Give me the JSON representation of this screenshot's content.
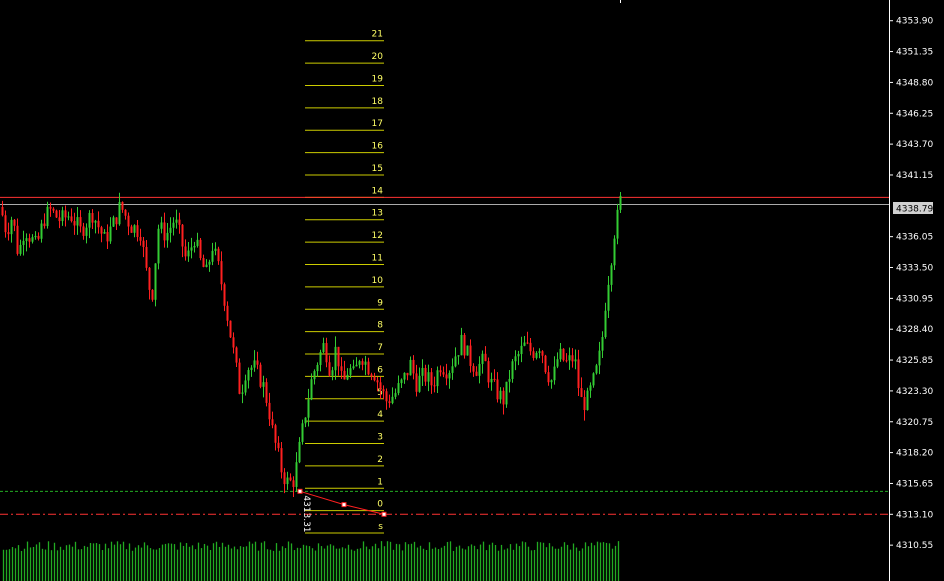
{
  "chart_data": {
    "type": "candlestick",
    "ylim": [
      4308.0,
      4355.2
    ],
    "y_ticks": [
      "4353.90",
      "4351.35",
      "4348.80",
      "4346.25",
      "4343.70",
      "4341.15",
      "4338.79",
      "4336.05",
      "4333.50",
      "4330.95",
      "4328.40",
      "4325.85",
      "4323.30",
      "4320.75",
      "4318.20",
      "4315.65",
      "4313.10",
      "4310.55"
    ],
    "current_price": "4338.79",
    "current_price_value": 4338.79,
    "resistance_value": 4339.3,
    "support_value": 4313.1,
    "dotted_level_value": 4315.0,
    "fib_levels": [
      "s",
      "0",
      "1",
      "2",
      "3",
      "4",
      "5",
      "6",
      "7",
      "8",
      "9",
      "10",
      "11",
      "12",
      "13",
      "14",
      "15",
      "16",
      "17",
      "18",
      "19",
      "20",
      "21"
    ],
    "fib_base_value": 4313.4,
    "fib_step": 1.85,
    "trend_line_points": [
      [
        4315.0
      ],
      [
        4313.9
      ],
      [
        4313.1
      ]
    ],
    "annotation_text": "4313.31",
    "colors": {
      "bull": "#33cc33",
      "bear": "#ff2020",
      "volume": "#22aa22",
      "fib": "#cccc00",
      "resistance": "#ff3333",
      "support": "#ff3333",
      "dotted": "#22aa22",
      "price_line": "#aaaaaa",
      "price_box": "#d0d0d0"
    },
    "anchors": [
      [
        0,
        4338.5
      ],
      [
        6,
        4336.5
      ],
      [
        12,
        4337.8
      ],
      [
        18,
        4334.5
      ],
      [
        24,
        4336.8
      ],
      [
        30,
        4336.0
      ],
      [
        36,
        4335.2
      ],
      [
        44,
        4337.6
      ],
      [
        50,
        4338.2
      ],
      [
        60,
        4337.4
      ],
      [
        70,
        4337.9
      ],
      [
        80,
        4336.5
      ],
      [
        92,
        4338.0
      ],
      [
        104,
        4335.8
      ],
      [
        112,
        4336.9
      ],
      [
        120,
        4338.6
      ],
      [
        130,
        4337.0
      ],
      [
        140,
        4336.5
      ],
      [
        148,
        4332.0
      ],
      [
        152,
        4331.5
      ],
      [
        158,
        4336.8
      ],
      [
        166,
        4336.2
      ],
      [
        174,
        4337.5
      ],
      [
        180,
        4336.0
      ],
      [
        186,
        4334.0
      ],
      [
        194,
        4336.0
      ],
      [
        200,
        4334.0
      ],
      [
        206,
        4333.0
      ],
      [
        212,
        4335.3
      ],
      [
        218,
        4333.5
      ],
      [
        224,
        4331.0
      ],
      [
        230,
        4328.0
      ],
      [
        236,
        4325.0
      ],
      [
        240,
        4323.0
      ],
      [
        246,
        4325.3
      ],
      [
        254,
        4325.2
      ],
      [
        262,
        4324.0
      ],
      [
        268,
        4322.0
      ],
      [
        272,
        4320.0
      ],
      [
        276,
        4318.5
      ],
      [
        282,
        4316.5
      ],
      [
        288,
        4315.6
      ],
      [
        294,
        4316.0
      ],
      [
        300,
        4319.0
      ],
      [
        306,
        4322.0
      ],
      [
        312,
        4324.5
      ],
      [
        318,
        4326.0
      ],
      [
        324,
        4327.2
      ],
      [
        330,
        4325.0
      ],
      [
        336,
        4327.0
      ],
      [
        342,
        4323.6
      ],
      [
        348,
        4325.2
      ],
      [
        354,
        4324.5
      ],
      [
        360,
        4326.5
      ],
      [
        366,
        4325.5
      ],
      [
        374,
        4324.8
      ],
      [
        380,
        4323.5
      ],
      [
        386,
        4322.5
      ],
      [
        394,
        4323.0
      ],
      [
        402,
        4324.0
      ],
      [
        410,
        4325.5
      ],
      [
        416,
        4324.0
      ],
      [
        424,
        4324.6
      ],
      [
        432,
        4323.8
      ],
      [
        440,
        4325.5
      ],
      [
        448,
        4325.0
      ],
      [
        456,
        4326.5
      ],
      [
        462,
        4327.5
      ],
      [
        468,
        4326.0
      ],
      [
        476,
        4325.2
      ],
      [
        484,
        4325.8
      ],
      [
        490,
        4324.0
      ],
      [
        498,
        4323.0
      ],
      [
        504,
        4322.5
      ],
      [
        510,
        4325.0
      ],
      [
        516,
        4326.0
      ],
      [
        524,
        4327.0
      ],
      [
        532,
        4326.5
      ],
      [
        540,
        4327.2
      ],
      [
        546,
        4325.0
      ],
      [
        552,
        4324.0
      ],
      [
        558,
        4326.3
      ],
      [
        566,
        4325.6
      ],
      [
        574,
        4326.1
      ],
      [
        580,
        4322.5
      ],
      [
        586,
        4322.3
      ],
      [
        592,
        4323.8
      ],
      [
        598,
        4325.5
      ],
      [
        602,
        4327.8
      ],
      [
        606,
        4331.5
      ],
      [
        610,
        4333.8
      ],
      [
        614,
        4336.5
      ],
      [
        618,
        4338.0
      ],
      [
        620,
        4339.0
      ]
    ]
  }
}
